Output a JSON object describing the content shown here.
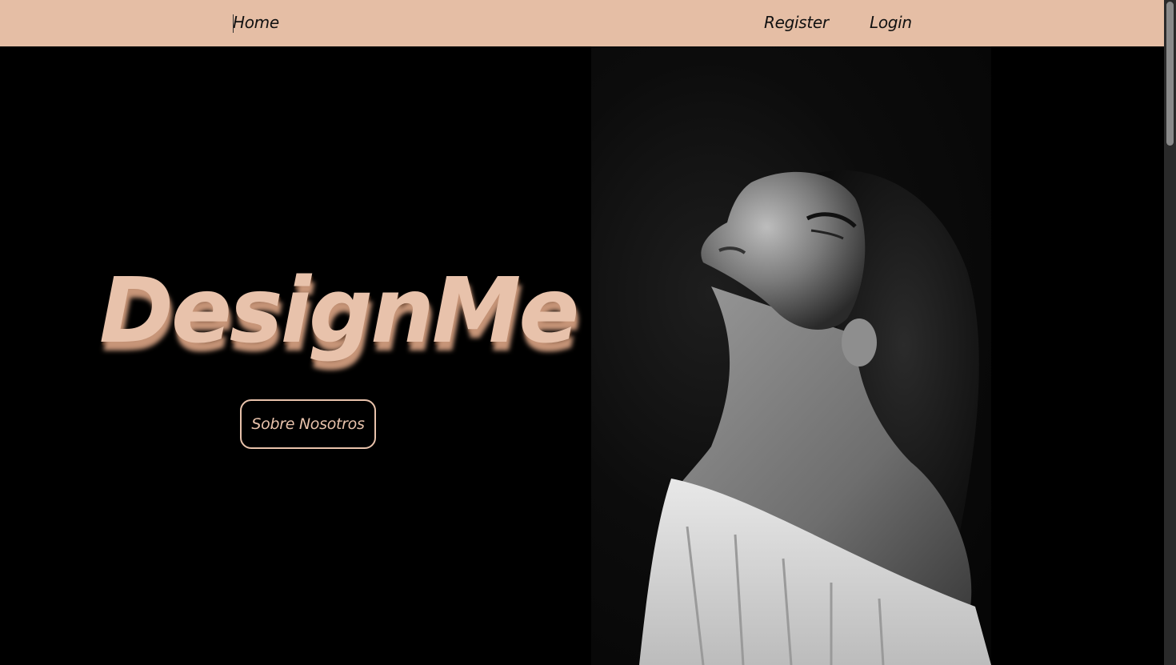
{
  "nav": {
    "home_label": "Home",
    "register_label": "Register",
    "login_label": "Login"
  },
  "hero": {
    "title": "DesignMe",
    "about_button_label": "Sobre Nosotros"
  },
  "colors": {
    "navbar_bg": "#e5bea5",
    "accent": "#e8c2ab",
    "background": "#000000"
  },
  "photo": {
    "icon": "portrait-photo"
  },
  "scrollbar": {
    "position_fraction": 0.0
  }
}
